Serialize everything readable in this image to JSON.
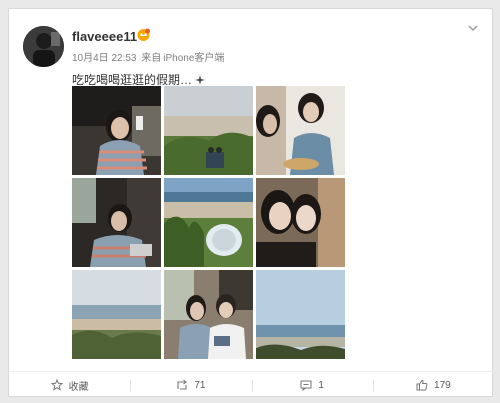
{
  "post": {
    "username": "flaveeee11",
    "vip_icon": "vip-crown-icon",
    "date": "10月4日 22:53",
    "source_prefix": "来自",
    "source": "iPhone客户端",
    "text": "吃吃喝喝逛逛的假期…",
    "text_emoji": "sparkle-icon"
  },
  "photos": [
    {
      "label": "photo-girl-drinking-cafe"
    },
    {
      "label": "photo-beach-bench"
    },
    {
      "label": "photo-two-girls-eating-noodles"
    },
    {
      "label": "photo-girl-laptop-window"
    },
    {
      "label": "photo-plants-and-lamp-seaside"
    },
    {
      "label": "photo-two-girls-selfie"
    },
    {
      "label": "photo-sea-horizon"
    },
    {
      "label": "photo-couple-reading"
    },
    {
      "label": "photo-clear-sky-coast"
    }
  ],
  "actions": {
    "favorite": {
      "label": "收藏",
      "icon": "star-icon"
    },
    "repost": {
      "count": "71",
      "icon": "repost-icon"
    },
    "comment": {
      "count": "1",
      "icon": "comment-icon"
    },
    "like": {
      "count": "179",
      "icon": "thumbs-up-icon"
    }
  },
  "colors": {
    "text": "#333333",
    "meta": "#808080",
    "vip": "#f7a700"
  }
}
